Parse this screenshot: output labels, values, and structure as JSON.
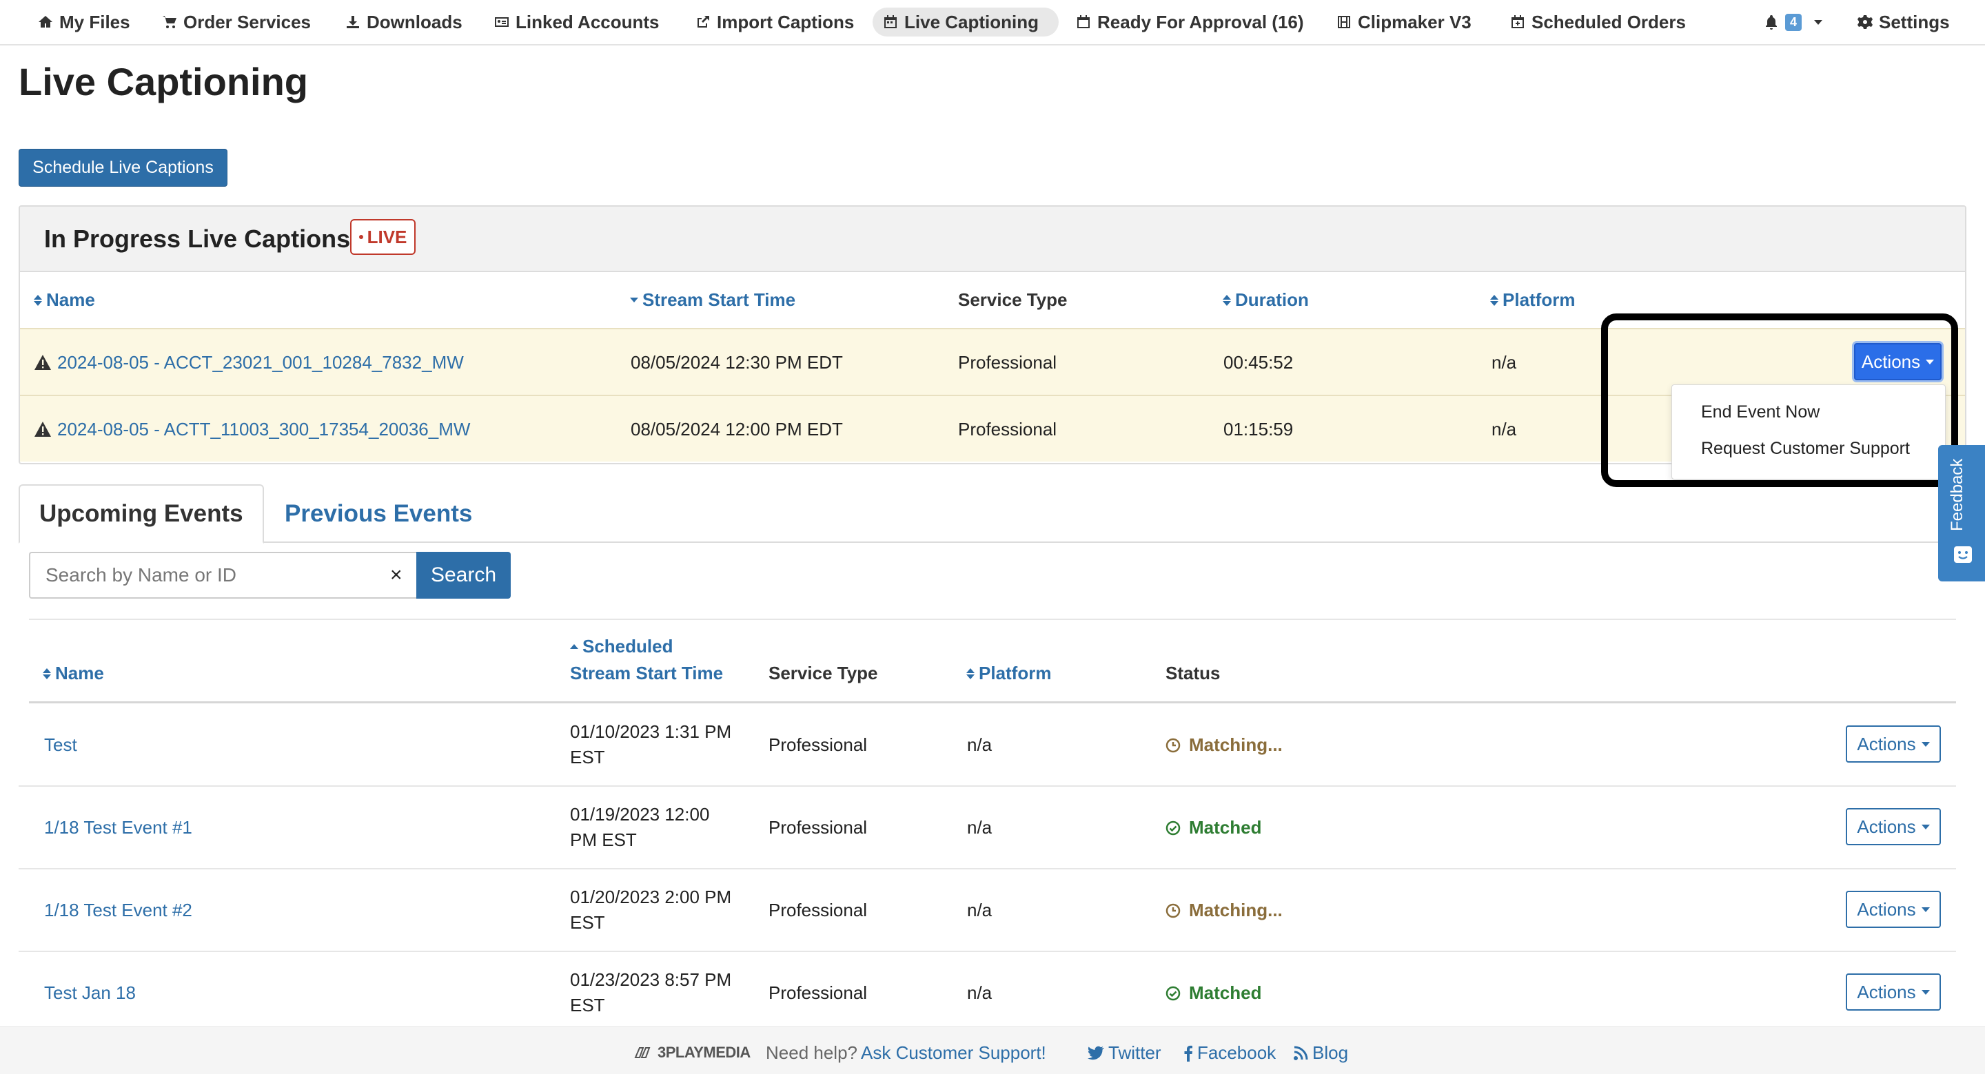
{
  "nav": {
    "my_files": "My Files",
    "order_services": "Order Services",
    "downloads": "Downloads",
    "linked_accounts": "Linked Accounts",
    "import_captions": "Import Captions",
    "live_captioning": "Live Captioning",
    "ready_for_approval": "Ready For Approval (16)",
    "clipmaker": "Clipmaker V3",
    "scheduled_orders": "Scheduled Orders",
    "notification_count": "4",
    "settings": "Settings"
  },
  "page": {
    "title": "Live Captioning",
    "schedule_button": "Schedule Live Captions"
  },
  "in_progress": {
    "title": "In Progress Live Captions",
    "live_badge": "LIVE",
    "columns": {
      "name": "Name",
      "stream_start": "Stream Start Time",
      "service_type": "Service Type",
      "duration": "Duration",
      "platform": "Platform"
    },
    "rows": [
      {
        "name": "2024-08-05 - ACCT_23021_001_10284_7832_MW",
        "start": "08/05/2024 12:30 PM EDT",
        "service": "Professional",
        "duration": "00:45:52",
        "platform": "n/a"
      },
      {
        "name": "2024-08-05 - ACTT_11003_300_17354_20036_MW",
        "start": "08/05/2024 12:00 PM EDT",
        "service": "Professional",
        "duration": "01:15:59",
        "platform": "n/a"
      }
    ],
    "actions_label": "Actions",
    "dropdown": [
      "End Event Now",
      "Request Customer Support"
    ]
  },
  "tabs": {
    "upcoming": "Upcoming Events",
    "previous": "Previous Events"
  },
  "search": {
    "placeholder": "Search by Name or ID",
    "clear": "×",
    "button": "Search"
  },
  "upcoming": {
    "columns": {
      "name": "Name",
      "scheduled_1": "Scheduled",
      "scheduled_2": "Stream Start Time",
      "service_type": "Service Type",
      "platform": "Platform",
      "status": "Status"
    },
    "rows": [
      {
        "name": "Test",
        "start_1": "01/10/2023 1:31 PM",
        "start_2": "EST",
        "service": "Professional",
        "platform": "n/a",
        "status": "Matching..."
      },
      {
        "name": "1/18 Test Event #1",
        "start_1": "01/19/2023 12:00",
        "start_2": "PM EST",
        "service": "Professional",
        "platform": "n/a",
        "status": "Matched"
      },
      {
        "name": "1/18 Test Event #2",
        "start_1": "01/20/2023 2:00 PM",
        "start_2": "EST",
        "service": "Professional",
        "platform": "n/a",
        "status": "Matching..."
      },
      {
        "name": "Test Jan 18",
        "start_1": "01/23/2023 8:57 PM",
        "start_2": "EST",
        "service": "Professional",
        "platform": "n/a",
        "status": "Matched"
      }
    ],
    "actions_label": "Actions"
  },
  "feedback": "Feedback",
  "footer": {
    "logo": "3PLAYMEDIA",
    "help_text": "Need help?",
    "help_link": "Ask Customer Support!",
    "twitter": "Twitter",
    "facebook": "Facebook",
    "blog": "Blog"
  },
  "colors": {
    "link": "#2d6ea8",
    "primary": "#2d6ea8",
    "live_red": "#c0392b",
    "in_progress_row": "#fcf8e3",
    "matching": "#8a6d3b",
    "matched": "#2e7d32"
  }
}
